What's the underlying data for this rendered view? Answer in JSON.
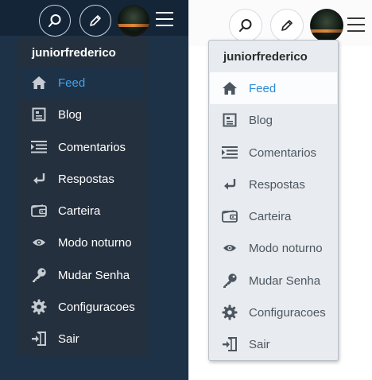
{
  "colors": {
    "dark_bg": "#1d3246",
    "dark_topbar": "#152538",
    "dark_menu_bg": "#25303e",
    "dark_active_text": "#46a3ea",
    "light_menu_bg": "#e8ecf0",
    "light_active_text": "#2e8ad6",
    "light_text": "#4d5660"
  },
  "themes": {
    "dark": {
      "username": "juniorfrederico",
      "items": [
        {
          "label": "Feed",
          "icon": "home-icon",
          "active": true
        },
        {
          "label": "Blog",
          "icon": "document-icon",
          "active": false
        },
        {
          "label": "Comentarios",
          "icon": "list-icon",
          "active": false
        },
        {
          "label": "Respostas",
          "icon": "reply-icon",
          "active": false
        },
        {
          "label": "Carteira",
          "icon": "wallet-icon",
          "active": false
        },
        {
          "label": "Modo noturno",
          "icon": "eye-icon",
          "active": false
        },
        {
          "label": "Mudar Senha",
          "icon": "key-icon",
          "active": false
        },
        {
          "label": "Configuracoes",
          "icon": "gear-icon",
          "active": false
        },
        {
          "label": "Sair",
          "icon": "logout-icon",
          "active": false
        }
      ]
    },
    "light": {
      "username": "juniorfrederico",
      "items": [
        {
          "label": "Feed",
          "icon": "home-icon",
          "active": true
        },
        {
          "label": "Blog",
          "icon": "document-icon",
          "active": false
        },
        {
          "label": "Comentarios",
          "icon": "list-icon",
          "active": false
        },
        {
          "label": "Respostas",
          "icon": "reply-icon",
          "active": false
        },
        {
          "label": "Carteira",
          "icon": "wallet-icon",
          "active": false
        },
        {
          "label": "Modo noturno",
          "icon": "eye-icon",
          "active": false
        },
        {
          "label": "Mudar Senha",
          "icon": "key-icon",
          "active": false
        },
        {
          "label": "Configuracoes",
          "icon": "gear-icon",
          "active": false
        },
        {
          "label": "Sair",
          "icon": "logout-icon",
          "active": false
        }
      ]
    }
  }
}
